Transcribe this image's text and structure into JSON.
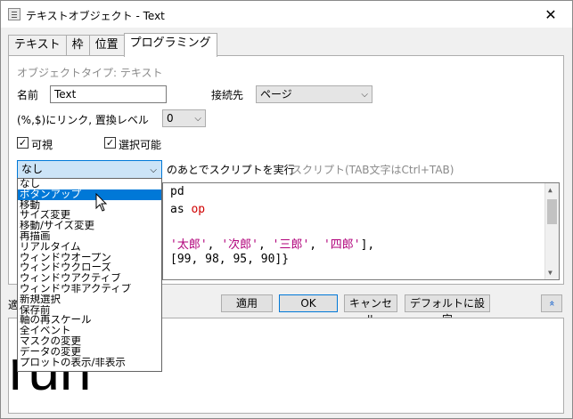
{
  "window": {
    "title": "テキストオブジェクト - Text",
    "close_glyph": "✕"
  },
  "tabs": [
    {
      "label": "テキスト",
      "active": false
    },
    {
      "label": "枠",
      "active": false
    },
    {
      "label": "位置",
      "active": false
    },
    {
      "label": "プログラミング",
      "active": true
    }
  ],
  "panel": {
    "object_type_label": "オブジェクトタイプ: テキスト",
    "name_label": "名前",
    "name_value": "Text",
    "connect_label": "接続先",
    "connect_value": "ページ",
    "link_label": "(%,$)にリンク, 置換レベル",
    "link_level_value": "0",
    "visible_label": "可視",
    "visible_checked": true,
    "selectable_label": "選択可能",
    "selectable_checked": true,
    "run_after_label": "のあとでスクリプトを実行",
    "script_hint": "スクリプト(TAB文字はCtrl+TAB)",
    "event_value": "なし"
  },
  "script_lines": [
    {
      "parts": [
        {
          "t": "pd",
          "c": ""
        }
      ]
    },
    {
      "parts": [
        {
          "t": "as ",
          "c": ""
        },
        {
          "t": "op",
          "c": "op"
        }
      ]
    },
    {
      "parts": [
        {
          "t": "'太郎'",
          "c": "str"
        },
        {
          "t": ", ",
          "c": ""
        },
        {
          "t": "'次郎'",
          "c": "str"
        },
        {
          "t": ", ",
          "c": ""
        },
        {
          "t": "'三郎'",
          "c": "str"
        },
        {
          "t": ", ",
          "c": ""
        },
        {
          "t": "'四郎'",
          "c": "str"
        },
        {
          "t": "],",
          "c": ""
        }
      ]
    },
    {
      "parts": [
        {
          "t": "[99, 98, 95, 90]}",
          "c": ""
        }
      ]
    }
  ],
  "buttons": {
    "apply": "適用",
    "ok": "OK",
    "cancel": "キャンセル",
    "set_default": "デフォルトに設定",
    "collapse_glyph": "»",
    "partial_label": "適"
  },
  "preview_text": "run",
  "dropdown_options": [
    "なし",
    "ボタンアップ",
    "移動",
    "サイズ変更",
    "移動/サイズ変更",
    "再描画",
    "リアルタイム",
    "ウィンドウオープン",
    "ウィンドウクローズ",
    "ウィンドウアクティブ",
    "ウィンドウ非アクティブ",
    "新規選択",
    "保存前",
    "軸の再スケール",
    "全イベント",
    "マスクの変更",
    "データの変更",
    "プロットの表示/非表示"
  ],
  "dropdown_selected_index": 1,
  "colors": {
    "accent": "#0078d7",
    "selection_bg": "#cce4f7",
    "string": "#b0007a",
    "operator": "#d00000"
  }
}
